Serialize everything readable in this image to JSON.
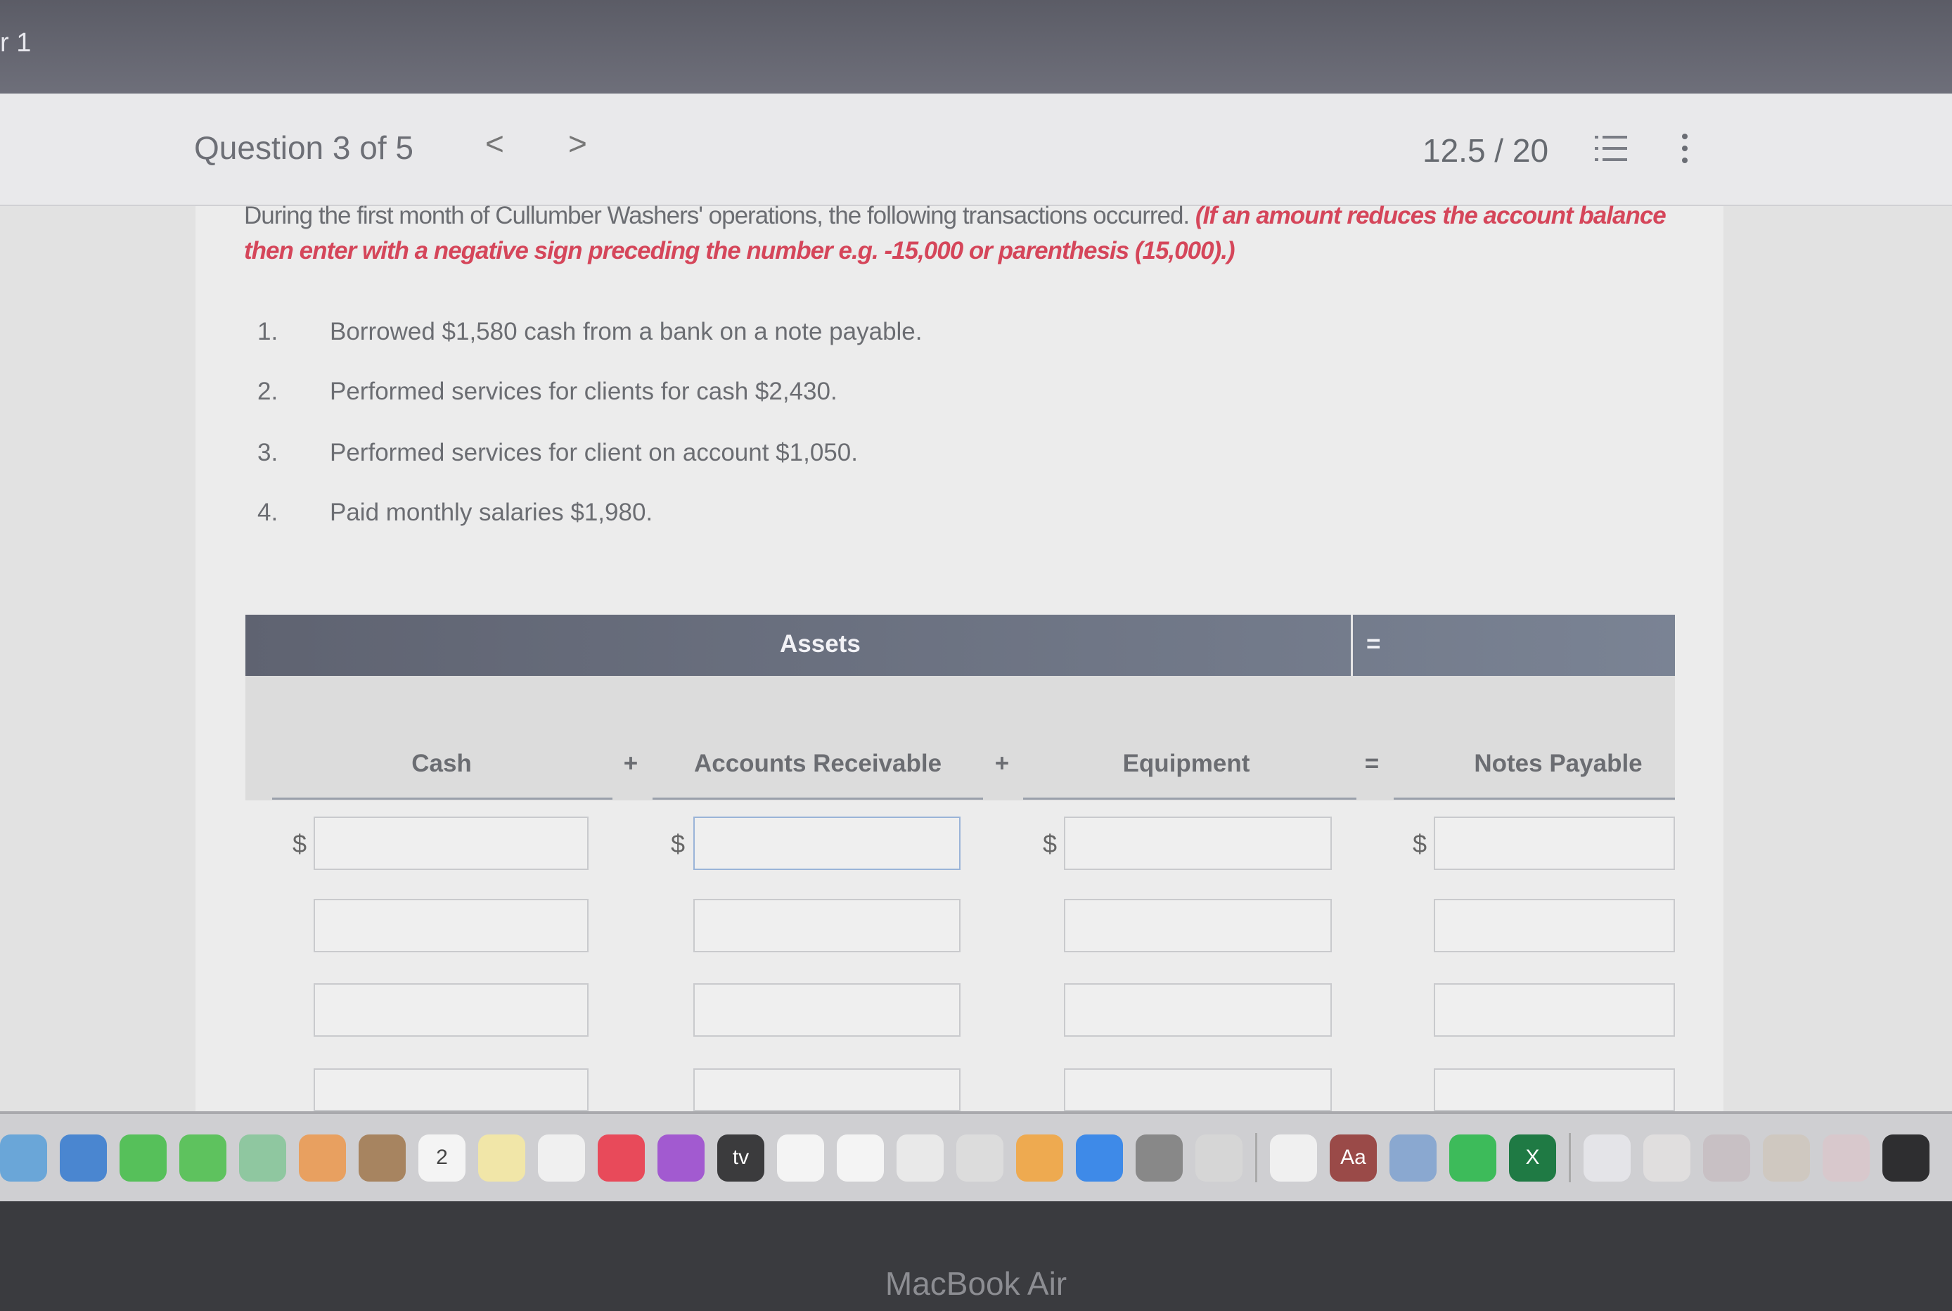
{
  "window": {
    "tab_fragment": "r 1"
  },
  "header": {
    "question": "Question 3 of 5",
    "prev": "<",
    "next": ">",
    "score": "12.5 / 20",
    "list_icon": "list-icon",
    "menu_icon": "kebab-icon"
  },
  "problem": {
    "intro": "During the first month of Cullumber Washers' operations, the following transactions occurred. ",
    "instruction": "(If an amount reduces the account balance then enter with a negative sign preceding the number e.g. -15,000 or parenthesis (15,000).)",
    "items": [
      {
        "num": "1.",
        "text": "Borrowed $1,580 cash from a bank on a note payable."
      },
      {
        "num": "2.",
        "text": "Performed services for clients for cash $2,430."
      },
      {
        "num": "3.",
        "text": "Performed services for client on account $1,050."
      },
      {
        "num": "4.",
        "text": "Paid monthly salaries $1,980."
      }
    ]
  },
  "table": {
    "group_header": "Assets",
    "equals": "=",
    "plus": "+",
    "dollar": "$",
    "columns": [
      "Cash",
      "Accounts Receivable",
      "Equipment",
      "Notes Payable"
    ]
  },
  "dock": {
    "apps": [
      {
        "name": "mail",
        "color": "#6aa6d8"
      },
      {
        "name": "safari",
        "color": "#4a86d0"
      },
      {
        "name": "facetime",
        "color": "#56c05a"
      },
      {
        "name": "messages",
        "color": "#5ec25e"
      },
      {
        "name": "maps",
        "color": "#8fc7a0"
      },
      {
        "name": "photos",
        "color": "#e8a060"
      },
      {
        "name": "contacts",
        "color": "#a78460"
      },
      {
        "name": "calendar",
        "color": "#f4f4f4",
        "label": "2"
      },
      {
        "name": "notes",
        "color": "#f1e6a8"
      },
      {
        "name": "freeform",
        "color": "#f0f0f0"
      },
      {
        "name": "music",
        "color": "#e84a5a"
      },
      {
        "name": "podcasts",
        "color": "#a25ad0"
      },
      {
        "name": "apple-tv",
        "color": "#3b3b3d",
        "label": "tv"
      },
      {
        "name": "reminders",
        "color": "#f4f4f4"
      },
      {
        "name": "news",
        "color": "#f4f4f4"
      },
      {
        "name": "numbers",
        "color": "#e9e9e9"
      },
      {
        "name": "keynote",
        "color": "#dcdcdc"
      },
      {
        "name": "pages",
        "color": "#eeaa50"
      },
      {
        "name": "app-store",
        "color": "#3e8ae8"
      },
      {
        "name": "system-settings",
        "color": "#888"
      },
      {
        "name": "help",
        "color": "#d6d6d6"
      },
      {
        "sep": true
      },
      {
        "name": "chrome",
        "color": "#f0f0f0"
      },
      {
        "name": "dictionary",
        "color": "#9a4a48",
        "label": "Aa"
      },
      {
        "name": "preview",
        "color": "#8aa8d0"
      },
      {
        "name": "spotify",
        "color": "#3dbb5a"
      },
      {
        "name": "excel",
        "color": "#1f7a44",
        "label": "X"
      },
      {
        "sep": true
      },
      {
        "name": "window-1",
        "color": "#e4e4e8"
      },
      {
        "name": "window-2",
        "color": "#e0dede"
      },
      {
        "name": "window-3",
        "color": "#c8c0c4"
      },
      {
        "name": "window-4",
        "color": "#cfc8c0"
      },
      {
        "name": "window-5",
        "color": "#d8c8cc"
      },
      {
        "name": "window-6",
        "color": "#2e2e30"
      }
    ]
  },
  "device": {
    "label": "MacBook Air"
  }
}
